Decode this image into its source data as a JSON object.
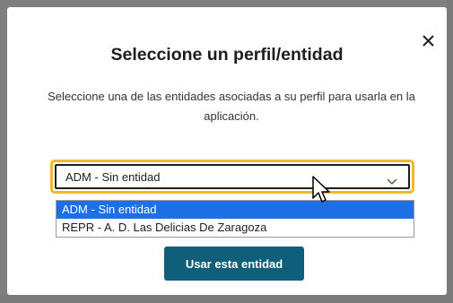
{
  "dialog": {
    "title": "Seleccione un perfil/entidad",
    "subtitle": "Seleccione una de las entidades asociadas a su perfil para usarla en la aplicación.",
    "close_icon": "close-icon"
  },
  "select": {
    "value": "ADM - Sin entidad",
    "chevron_icon": "chevron-down-icon",
    "options": [
      {
        "label": "ADM - Sin entidad",
        "selected": true
      },
      {
        "label": "REPR - A. D. Las Delicias De Zaragoza",
        "selected": false
      }
    ]
  },
  "actions": {
    "use_entity_label": "Usar esta entidad"
  },
  "colors": {
    "focus_ring": "#f0b82a",
    "primary_button": "#0f5e7a",
    "option_highlight": "#1e6fe6"
  }
}
